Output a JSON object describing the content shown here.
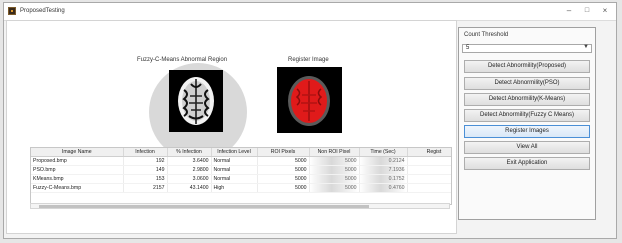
{
  "window": {
    "title": "ProposedTesting",
    "minimize": "–",
    "maximize": "□",
    "close": "×"
  },
  "images": {
    "fuzzy_label": "Fuzzy-C-Means Abnormal Region",
    "register_label": "Register Image"
  },
  "table": {
    "headers": [
      "Image Name",
      "Infection",
      "% Infection",
      "Infection Level",
      "ROI Pixels",
      "Non ROI Pixel",
      "Time (Sec)",
      "Regist"
    ],
    "rows": [
      [
        "Proposed.bmp",
        "192",
        "3.6400",
        "Normal",
        "5000",
        "5000",
        "0.2124"
      ],
      [
        "PSO.bmp",
        "149",
        "2.9800",
        "Normal",
        "5000",
        "5000",
        "7.1936"
      ],
      [
        "KMeans.bmp",
        "153",
        "3.0600",
        "Normal",
        "5000",
        "5000",
        "0.1752"
      ],
      [
        "Fuzzy-C-Means.bmp",
        "2157",
        "43.1400",
        "High",
        "5000",
        "5000",
        "0.4760"
      ]
    ]
  },
  "panel": {
    "threshold_label": "Count Threshold",
    "threshold_value": "5",
    "buttons": [
      "Detect Abnormility(Proposed)",
      "Detect Abnormility(PSO)",
      "Detect Abnormility(K-Means)",
      "Detect Abnormility(Fuzzy C Means)",
      "Register Images",
      "View All",
      "Exit Application"
    ]
  }
}
